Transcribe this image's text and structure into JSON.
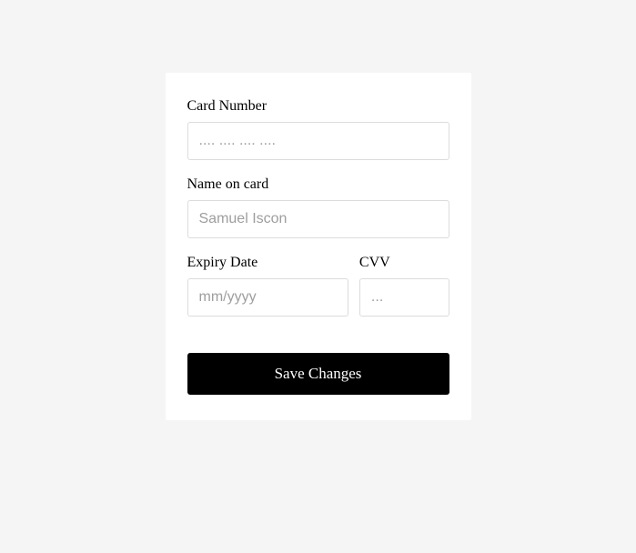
{
  "form": {
    "cardNumber": {
      "label": "Card Number",
      "placeholder": ".... .... .... ....",
      "value": ""
    },
    "nameOnCard": {
      "label": "Name on card",
      "placeholder": "Samuel Iscon",
      "value": ""
    },
    "expiryDate": {
      "label": "Expiry Date",
      "placeholder": "mm/yyyy",
      "value": ""
    },
    "cvv": {
      "label": "CVV",
      "placeholder": "...",
      "value": ""
    },
    "saveButton": "Save Changes"
  }
}
